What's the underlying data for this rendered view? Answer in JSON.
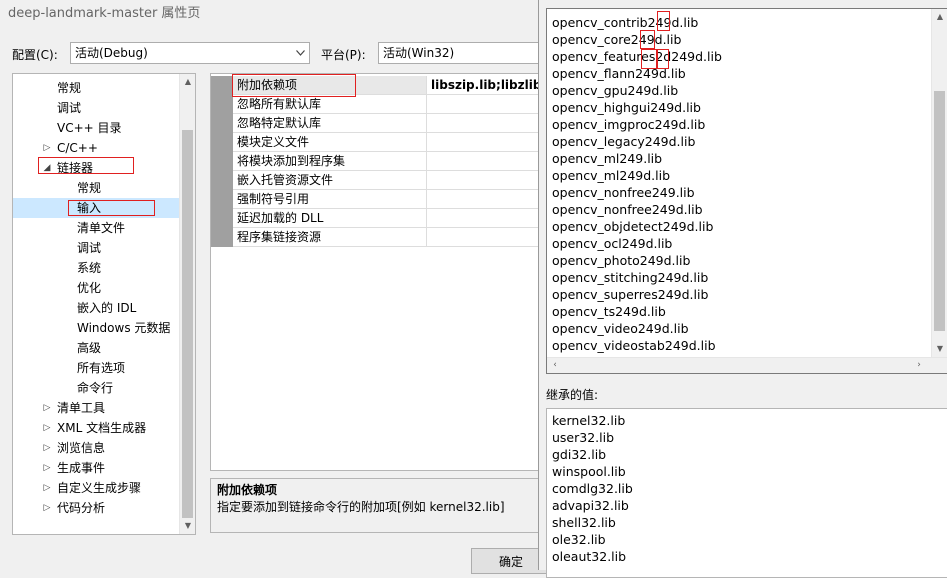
{
  "window": {
    "title": "deep-landmark-master 属性页"
  },
  "config": {
    "config_label": "配置(C):",
    "config_value": "活动(Debug)",
    "platform_label": "平台(P):",
    "platform_value": "活动(Win32)"
  },
  "tree": {
    "items": [
      {
        "label": "常规"
      },
      {
        "label": "调试"
      },
      {
        "label": "VC++ 目录"
      },
      {
        "label": "C/C++"
      },
      {
        "label": "链接器"
      },
      {
        "label": "常规"
      },
      {
        "label": "输入"
      },
      {
        "label": "清单文件"
      },
      {
        "label": "调试"
      },
      {
        "label": "系统"
      },
      {
        "label": "优化"
      },
      {
        "label": "嵌入的 IDL"
      },
      {
        "label": "Windows 元数据"
      },
      {
        "label": "高级"
      },
      {
        "label": "所有选项"
      },
      {
        "label": "命令行"
      },
      {
        "label": "清单工具"
      },
      {
        "label": "XML 文档生成器"
      },
      {
        "label": "浏览信息"
      },
      {
        "label": "生成事件"
      },
      {
        "label": "自定义生成步骤"
      },
      {
        "label": "代码分析"
      }
    ],
    "selected": "输入"
  },
  "grid": {
    "rows": [
      {
        "name": "附加依赖项",
        "value": "libszip.lib;libzlib.lib"
      },
      {
        "name": "忽略所有默认库",
        "value": ""
      },
      {
        "name": "忽略特定默认库",
        "value": ""
      },
      {
        "name": "模块定义文件",
        "value": ""
      },
      {
        "name": "将模块添加到程序集",
        "value": ""
      },
      {
        "name": "嵌入托管资源文件",
        "value": ""
      },
      {
        "name": "强制符号引用",
        "value": ""
      },
      {
        "name": "延迟加载的 DLL",
        "value": ""
      },
      {
        "name": "程序集链接资源",
        "value": ""
      }
    ]
  },
  "description": {
    "heading": "附加依赖项",
    "body": "指定要添加到链接命令行的附加项[例如 kernel32.lib]"
  },
  "buttons": {
    "ok": "确定"
  },
  "popup": {
    "lines": [
      "opencv_contrib249d.lib",
      "opencv_core249d.lib",
      "opencv_features2d249d.lib",
      "opencv_flann249d.lib",
      "opencv_gpu249d.lib",
      "opencv_highgui249d.lib",
      "opencv_imgproc249d.lib",
      "opencv_legacy249d.lib",
      "opencv_ml249.lib",
      "opencv_ml249d.lib",
      "opencv_nonfree249.lib",
      "opencv_nonfree249d.lib",
      "opencv_objdetect249d.lib",
      "opencv_ocl249d.lib",
      "opencv_photo249d.lib",
      "opencv_stitching249d.lib",
      "opencv_superres249d.lib",
      "opencv_ts249d.lib",
      "opencv_video249d.lib",
      "opencv_videostab249d.lib"
    ],
    "inherited_label": "继承的值:",
    "inherited": [
      "kernel32.lib",
      "user32.lib",
      "gdi32.lib",
      "winspool.lib",
      "comdlg32.lib",
      "advapi32.lib",
      "shell32.lib",
      "ole32.lib",
      "oleaut32.lib"
    ]
  }
}
